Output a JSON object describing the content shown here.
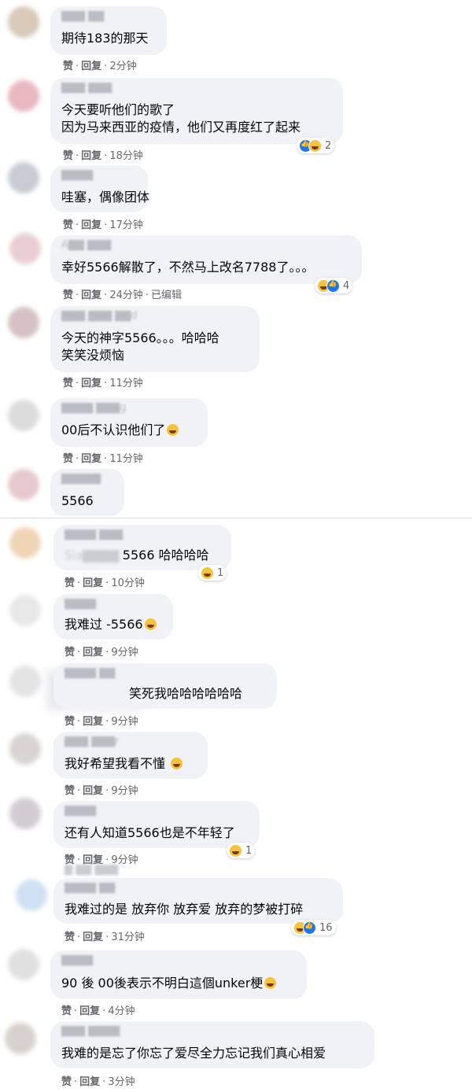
{
  "actions": {
    "like": "赞",
    "reply": "回复",
    "edited": "已编辑"
  },
  "comments": [
    {
      "text": [
        "期待183的那天"
      ],
      "time": "2分钟"
    },
    {
      "text": [
        "今天要听他们的歌了",
        "因为马来西亚的疫情，他们又再度红了起来"
      ],
      "time": "18分钟",
      "reactions": {
        "icons": [
          "like-icon",
          "haha-icon"
        ],
        "count": "2"
      }
    },
    {
      "text": [
        "哇塞，偶像团体"
      ],
      "time": "17分钟"
    },
    {
      "text": [
        "幸好5566解散了，不然马上改名7788了。。。"
      ],
      "time": "24分钟",
      "reactions": {
        "icons": [
          "haha-icon",
          "like-icon"
        ],
        "count": "4"
      }
    },
    {
      "text": [
        "今天的神字5566。。。哈哈哈",
        "笑笑没烦恼"
      ],
      "time": "11分钟"
    },
    {
      "text": [
        "00后不认识他们了"
      ],
      "time": "11分钟"
    },
    {
      "text": [
        "5566"
      ]
    },
    {
      "text": [
        "5566 哈哈哈哈"
      ],
      "time": "10分钟",
      "reactions": {
        "icons": [
          "haha-icon"
        ],
        "count": "1"
      }
    },
    {
      "text": [
        "我难过 -5566"
      ],
      "time": "9分钟"
    },
    {
      "text": [
        "笑死我哈哈哈哈哈哈"
      ],
      "time": "9分钟"
    },
    {
      "text": [
        "我好希望我看不懂"
      ],
      "time": "9分钟"
    },
    {
      "text": [
        "还有人知道5566也是不年轻了"
      ],
      "time": "9分钟",
      "reactions": {
        "icons": [
          "haha-icon"
        ],
        "count": "1"
      }
    },
    {
      "text": [
        "我难过的是 放弃你 放弃爱 放弃的梦被打碎"
      ],
      "time": "31分钟",
      "reactions": {
        "icons": [
          "haha-icon",
          "like-icon"
        ],
        "count": "16"
      }
    },
    {
      "text": [
        "90 後 00後表示不明白這個unker梗"
      ],
      "time": "4分钟"
    },
    {
      "text": [
        "我难的是忘了你忘了爱尽全力忘记我们真心相爱"
      ],
      "time": "3分钟"
    }
  ]
}
